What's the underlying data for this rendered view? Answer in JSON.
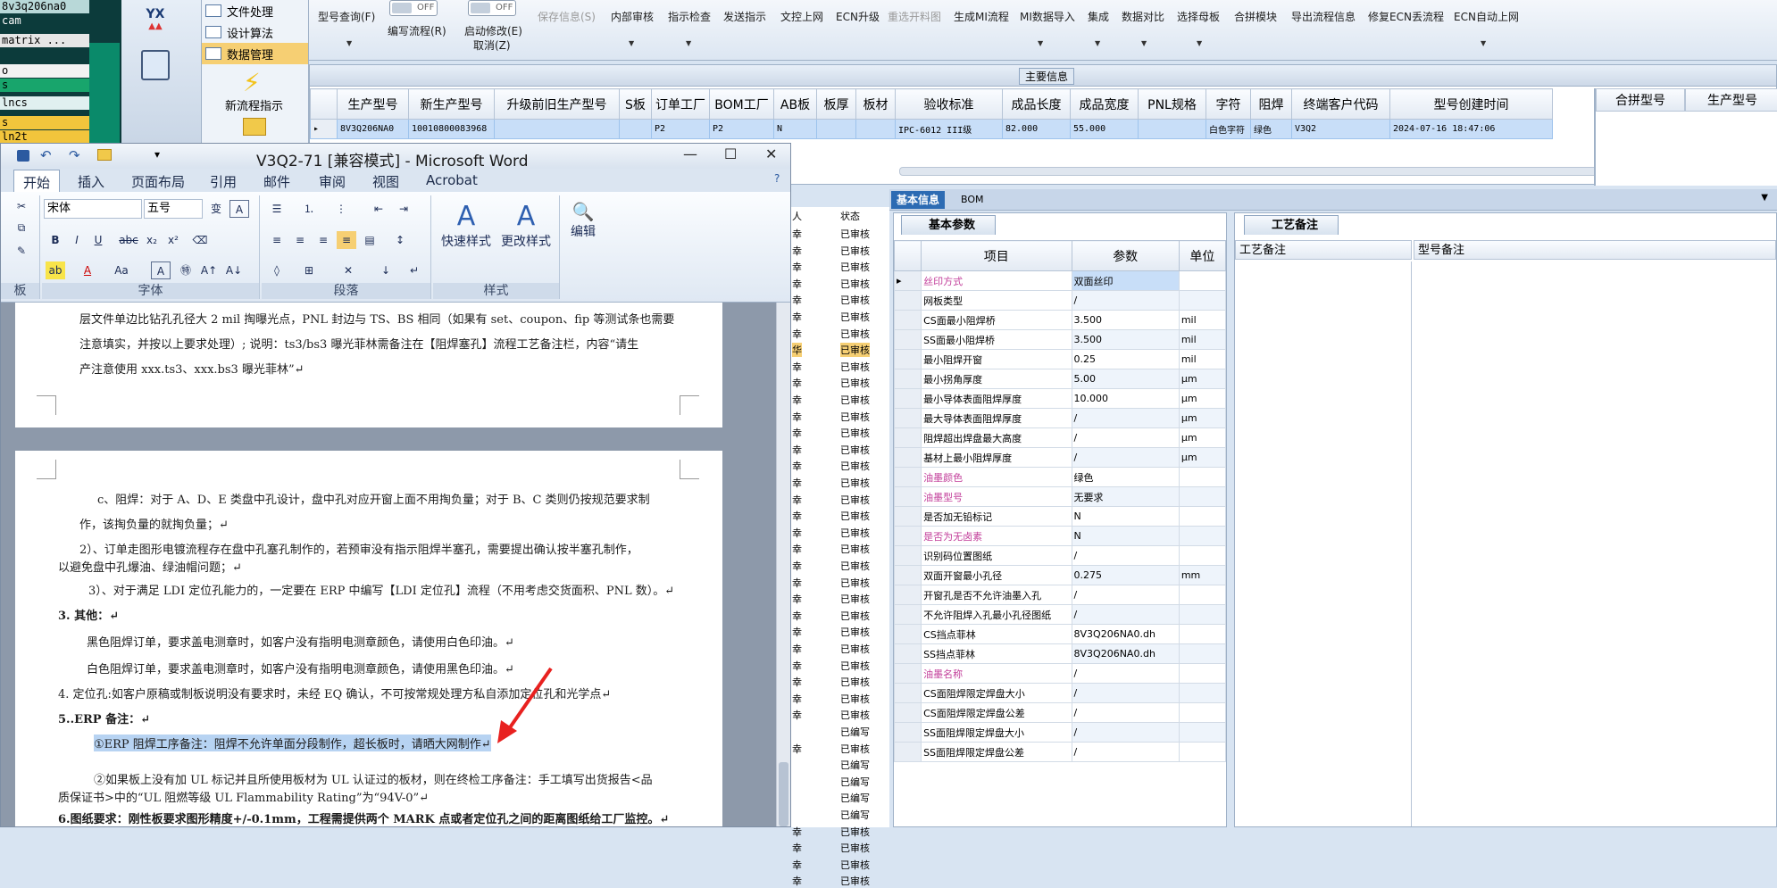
{
  "terminal": {
    "lines": [
      "8v3q206na0",
      "cam",
      "matrix ...",
      "o",
      "s",
      "lncs",
      "s",
      "ln2t"
    ]
  },
  "nav": {
    "items": [
      {
        "label": "文件处理"
      },
      {
        "label": "设计算法"
      },
      {
        "label": "数据管理"
      }
    ],
    "new_process": "新流程指示",
    "yx_label": "YX"
  },
  "toolbar": {
    "items": [
      {
        "label": "型号查询(F)",
        "disabled": false
      },
      {
        "label": "编写流程(R)",
        "disabled": false
      },
      {
        "label": "启动修改(E)",
        "disabled": false
      },
      {
        "label": "取消(Z)",
        "disabled": false
      },
      {
        "label": "保存信息(S)",
        "disabled": true
      },
      {
        "label": "内部审核",
        "disabled": false
      },
      {
        "label": "指示检查",
        "disabled": false
      },
      {
        "label": "发送指示",
        "disabled": false
      },
      {
        "label": "文控上网",
        "disabled": false
      },
      {
        "label": "ECN升级",
        "disabled": false
      },
      {
        "label": "重选开料图",
        "disabled": true
      },
      {
        "label": "生成MI流程",
        "disabled": false
      },
      {
        "label": "MI数据导入",
        "disabled": false
      },
      {
        "label": "集成",
        "disabled": false
      },
      {
        "label": "数据对比",
        "disabled": false
      },
      {
        "label": "选择母板",
        "disabled": false
      },
      {
        "label": "合拼模块",
        "disabled": false
      },
      {
        "label": "导出流程信息",
        "disabled": false
      },
      {
        "label": "修复ECN丢流程",
        "disabled": false
      },
      {
        "label": "ECN自动上网",
        "disabled": false
      }
    ],
    "toggle_off": "OFF"
  },
  "main_info": {
    "caption": "主要信息",
    "columns": [
      "生产型号",
      "新生产型号",
      "升级前旧生产型号",
      "S板",
      "订单工厂",
      "BOM工厂",
      "AB板",
      "板厚",
      "板材",
      "验收标准",
      "成品长度",
      "成品宽度",
      "PNL规格",
      "字符",
      "阻焊",
      "终端客户代码",
      "型号创建时间"
    ],
    "row": [
      "8V3Q206NA0",
      "10010800083968",
      "",
      "",
      "P2",
      "P2",
      "N",
      "",
      "",
      "IPC-6012 III级",
      "82.000",
      "55.000",
      "",
      "白色字符",
      "绿色",
      "V3Q2",
      "2024-07-16 18:47:06"
    ],
    "right_columns": [
      "合拼型号",
      "生产型号"
    ]
  },
  "tabs2": {
    "active": "基本信息",
    "other": "BOM"
  },
  "basic_params": {
    "tab": "基本参数",
    "headers": [
      "项目",
      "参数",
      "单位"
    ],
    "rows": [
      {
        "item": "丝印方式",
        "value": "双面丝印",
        "unit": "",
        "pink": true
      },
      {
        "item": "网板类型",
        "value": "/",
        "unit": "",
        "pink": false
      },
      {
        "item": "CS面最小阻焊桥",
        "value": "3.500",
        "unit": "mil",
        "pink": false
      },
      {
        "item": "SS面最小阻焊桥",
        "value": "3.500",
        "unit": "mil",
        "pink": false
      },
      {
        "item": "最小阻焊开窗",
        "value": "0.25",
        "unit": "mil",
        "pink": false
      },
      {
        "item": "最小拐角厚度",
        "value": "5.00",
        "unit": "μm",
        "pink": false
      },
      {
        "item": "最小导体表面阻焊厚度",
        "value": "10.000",
        "unit": "μm",
        "pink": false
      },
      {
        "item": "最大导体表面阻焊厚度",
        "value": "/",
        "unit": "μm",
        "pink": false
      },
      {
        "item": "阻焊超出焊盘最大高度",
        "value": "/",
        "unit": "μm",
        "pink": false
      },
      {
        "item": "基材上最小阻焊厚度",
        "value": "/",
        "unit": "μm",
        "pink": false
      },
      {
        "item": "油墨颜色",
        "value": "绿色",
        "unit": "",
        "pink": true
      },
      {
        "item": "油墨型号",
        "value": "无要求",
        "unit": "",
        "pink": true
      },
      {
        "item": "是否加无铅标记",
        "value": "N",
        "unit": "",
        "pink": false
      },
      {
        "item": "是否为无卤素",
        "value": "N",
        "unit": "",
        "pink": true
      },
      {
        "item": "识别码位置图纸",
        "value": "/",
        "unit": "",
        "pink": false
      },
      {
        "item": "双面开窗最小孔径",
        "value": "0.275",
        "unit": "mm",
        "pink": false
      },
      {
        "item": "开窗孔是否不允许油墨入孔",
        "value": "/",
        "unit": "",
        "pink": false
      },
      {
        "item": "不允许阻焊入孔最小孔径图纸",
        "value": "/",
        "unit": "",
        "pink": false
      },
      {
        "item": "CS挡点菲林",
        "value": "8V3Q206NA0.dh",
        "unit": "",
        "pink": false
      },
      {
        "item": "SS挡点菲林",
        "value": "8V3Q206NA0.dh",
        "unit": "",
        "pink": false
      },
      {
        "item": "油墨名称",
        "value": "/",
        "unit": "",
        "pink": true
      },
      {
        "item": "CS面阻焊限定焊盘大小",
        "value": "/",
        "unit": "",
        "pink": false
      },
      {
        "item": "CS面阻焊限定焊盘公差",
        "value": "/",
        "unit": "",
        "pink": false
      },
      {
        "item": "SS面阻焊限定焊盘大小",
        "value": "/",
        "unit": "",
        "pink": false
      },
      {
        "item": "SS面阻焊限定焊盘公差",
        "value": "/",
        "unit": "",
        "pink": false
      }
    ]
  },
  "process_notes": {
    "tab": "工艺备注",
    "col1": "工艺备注",
    "col2": "型号备注"
  },
  "status_col": {
    "headers": [
      "人",
      "状态"
    ],
    "rows": [
      {
        "l": "幸",
        "r": "已审核"
      },
      {
        "l": "幸",
        "r": "已审核"
      },
      {
        "l": "幸",
        "r": "已审核"
      },
      {
        "l": "幸",
        "r": "已审核"
      },
      {
        "l": "幸",
        "r": "已审核"
      },
      {
        "l": "幸",
        "r": "已审核"
      },
      {
        "l": "幸",
        "r": "已审核"
      },
      {
        "l": "华",
        "r": "已审核"
      },
      {
        "l": "幸",
        "r": "已审核"
      },
      {
        "l": "幸",
        "r": "已审核"
      },
      {
        "l": "幸",
        "r": "已审核"
      },
      {
        "l": "幸",
        "r": "已审核"
      },
      {
        "l": "幸",
        "r": "已审核"
      },
      {
        "l": "幸",
        "r": "已审核"
      },
      {
        "l": "幸",
        "r": "已审核"
      },
      {
        "l": "幸",
        "r": "已审核"
      },
      {
        "l": "幸",
        "r": "已审核"
      },
      {
        "l": "幸",
        "r": "已审核"
      },
      {
        "l": "幸",
        "r": "已审核"
      },
      {
        "l": "幸",
        "r": "已审核"
      },
      {
        "l": "幸",
        "r": "已审核"
      },
      {
        "l": "幸",
        "r": "已审核"
      },
      {
        "l": "幸",
        "r": "已审核"
      },
      {
        "l": "幸",
        "r": "已审核"
      },
      {
        "l": "幸",
        "r": "已审核"
      },
      {
        "l": "幸",
        "r": "已审核"
      },
      {
        "l": "幸",
        "r": "已审核"
      },
      {
        "l": "幸",
        "r": "已审核"
      },
      {
        "l": "幸",
        "r": "已审核"
      },
      {
        "l": "幸",
        "r": "已审核"
      },
      {
        "l": "",
        "r": "已编写"
      },
      {
        "l": "幸",
        "r": "已审核"
      },
      {
        "l": "",
        "r": "已编写"
      },
      {
        "l": "",
        "r": "已编写"
      },
      {
        "l": "",
        "r": "已编写"
      },
      {
        "l": "",
        "r": "已编写"
      },
      {
        "l": "幸",
        "r": "已审核"
      },
      {
        "l": "幸",
        "r": "已审核"
      },
      {
        "l": "幸",
        "r": "已审核"
      },
      {
        "l": "幸",
        "r": "已审核"
      }
    ]
  },
  "word": {
    "title": "V3Q2-71 [兼容模式] - Microsoft Word",
    "tabs": [
      "开始",
      "插入",
      "页面布局",
      "引用",
      "邮件",
      "审阅",
      "视图",
      "Acrobat"
    ],
    "font_name": "宋体",
    "font_size": "五号",
    "groups": {
      "font": "字体",
      "paragraph": "段落",
      "styles": "样式",
      "clipboard": "板"
    },
    "quick_styles": "快速样式",
    "change_styles": "更改样式",
    "edit": "编辑",
    "page1": [
      "层文件单边比钻孔孔径大 2 mil 掏曝光点，PNL 封边与 TS、BS 相同（如果有 set、coupon、fip 等测试条也需要",
      "注意填实，并按以上要求处理）; 说明：ts3/bs3 曝光菲林需备注在【阻焊塞孔】流程工艺备注栏，内容“请生",
      "产注意使用 xxx.ts3、xxx.bs3 曝光菲林”↵"
    ],
    "page2": [
      "c、阻焊：对于 A、D、E 类盘中孔设计，盘中孔对应开窗上面不用掏负量；对于 B、C 类则仍按规范要求制",
      "作，该掏负量的就掏负量；↵",
      "2）、订单走图形电镀流程存在盘中孔塞孔制作的，若预审没有指示阻焊半塞孔，需要提出确认按半塞孔制作，",
      "以避免盘中孔爆油、绿油帽问题；↵",
      "3）、对于满足 LDI 定位孔能力的，一定要在 ERP 中编写【LDI 定位孔】流程（不用考虑交货面积、PNL 数）。↵",
      "3. 其他：↵",
      "黑色阻焊订单，要求盖电测章时，如客户没有指明电测章颜色，请使用白色印油。↵",
      "白色阻焊订单，要求盖电测章时，如客户没有指明电测章颜色，请使用黑色印油。↵",
      "4. 定位孔:如客户原稿或制板说明没有要求时，未经 EQ 确认，不可按常规处理方私自添加定位孔和光学点↵",
      "5..ERP 备注：↵",
      "①ERP 阻焊工序备注：阻焊不允许单面分段制作，超长板时，请晒大网制作↵",
      "②如果板上没有加 UL 标记并且所使用板材为 UL 认证过的板材，则在终检工序备注：手工填写出货报告<品",
      "质保证书>中的“UL 阻燃等级 UL Flammability Rating”为“94V-0”↵",
      "6.图纸要求：刚性板要求图形精度+/-0.1mm，工程需提供两个 MARK 点或者定位孔之间的距离图纸给工厂监控。↵"
    ]
  },
  "colors": {
    "accent": "#2c6bb3",
    "selection": "#c8def8",
    "highlight_orange": "#f6cf73",
    "annotation_arrow": "#e8211f",
    "pink_label": "#c23e9a"
  }
}
